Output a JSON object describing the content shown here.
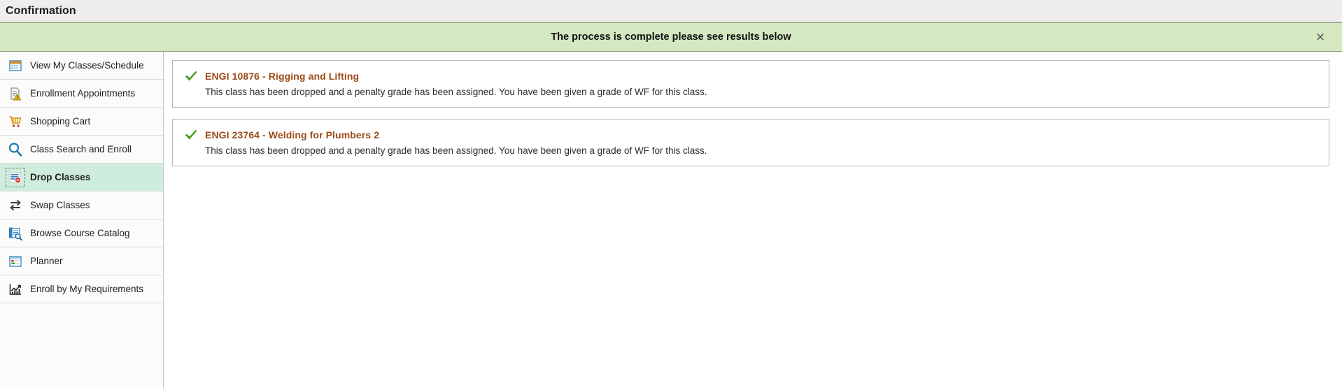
{
  "header": {
    "title": "Confirmation"
  },
  "banner": {
    "message": "The process is complete please see results below",
    "close_label": "×",
    "background_color": "#d4e8c2"
  },
  "sidebar": {
    "items": [
      {
        "label": "View My Classes/Schedule",
        "icon": "calendar-icon",
        "selected": false
      },
      {
        "label": "Enrollment Appointments",
        "icon": "document-warning-icon",
        "selected": false
      },
      {
        "label": "Shopping Cart",
        "icon": "shopping-cart-icon",
        "selected": false
      },
      {
        "label": "Class Search and Enroll",
        "icon": "magnifier-icon",
        "selected": false
      },
      {
        "label": "Drop Classes",
        "icon": "drop-classes-icon",
        "selected": true
      },
      {
        "label": "Swap Classes",
        "icon": "swap-arrows-icon",
        "selected": false
      },
      {
        "label": "Browse Course Catalog",
        "icon": "catalog-search-icon",
        "selected": false
      },
      {
        "label": "Planner",
        "icon": "planner-icon",
        "selected": false
      },
      {
        "label": "Enroll by My Requirements",
        "icon": "chart-requirements-icon",
        "selected": false
      }
    ]
  },
  "main": {
    "results": [
      {
        "status_icon": "green-check-icon",
        "title": "ENGI 10876 - Rigging and Lifting",
        "description": "This class has been dropped and a penalty grade has been assigned. You have been given a grade of WF for this class."
      },
      {
        "status_icon": "green-check-icon",
        "title": "ENGI 23764 - Welding for Plumbers 2",
        "description": "This class has been dropped and a penalty grade has been assigned. You have been given a grade of WF for this class."
      }
    ]
  },
  "colors": {
    "success_green": "#4a9b22",
    "title_orange": "#9c4a16",
    "selected_nav": "#cfeddc"
  }
}
